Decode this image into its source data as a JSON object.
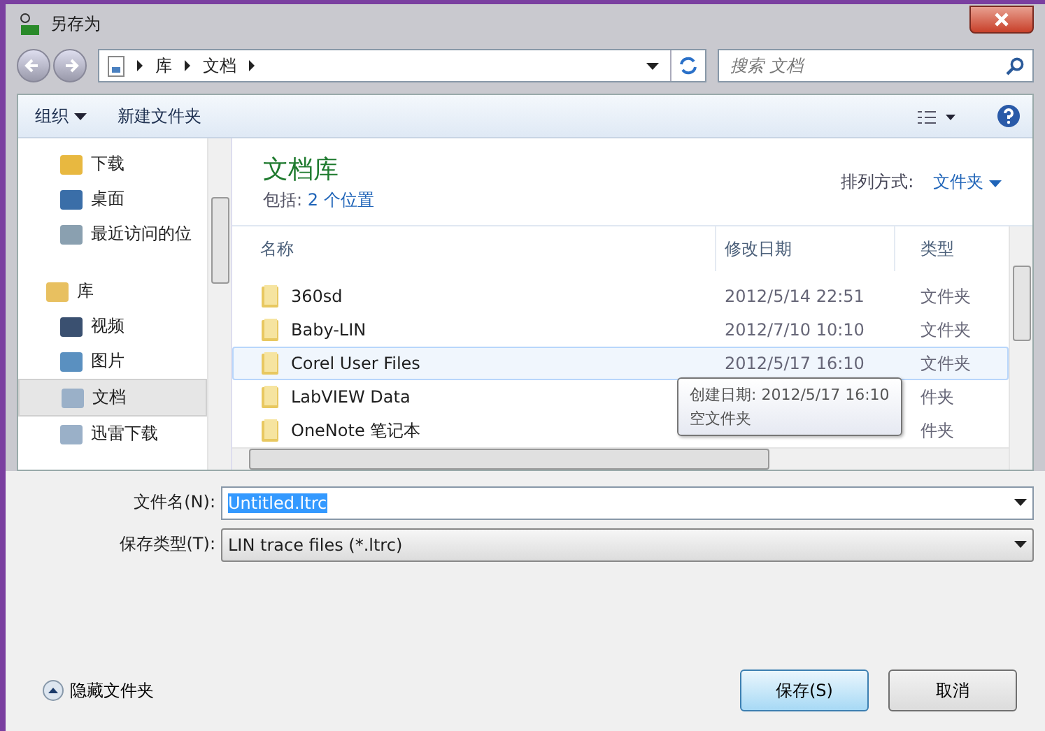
{
  "window": {
    "title": "另存为"
  },
  "address": {
    "crumbs": [
      "库",
      "文档"
    ]
  },
  "search": {
    "placeholder": "搜索 文档"
  },
  "toolbar": {
    "organize": "组织",
    "new_folder": "新建文件夹"
  },
  "nav": {
    "favorites": [
      {
        "label": "下载",
        "kind": "download",
        "selected": false
      },
      {
        "label": "桌面",
        "kind": "desktop",
        "selected": false
      },
      {
        "label": "最近访问的位",
        "kind": "recent",
        "selected": false
      }
    ],
    "library": {
      "label": "库",
      "children": [
        {
          "label": "视频",
          "kind": "video",
          "selected": false
        },
        {
          "label": "图片",
          "kind": "picture",
          "selected": false
        },
        {
          "label": "文档",
          "kind": "document",
          "selected": true
        },
        {
          "label": "迅雷下载",
          "kind": "document",
          "selected": false
        }
      ]
    }
  },
  "library": {
    "title": "文档库",
    "includes_label": "包括:",
    "includes_link": "2 个位置",
    "arrange_label": "排列方式:",
    "arrange_value": "文件夹"
  },
  "columns": [
    "名称",
    "修改日期",
    "类型"
  ],
  "rows": [
    {
      "name": "360sd",
      "date": "2012/5/14 22:51",
      "type": "文件夹",
      "selected": false
    },
    {
      "name": "Baby-LIN",
      "date": "2012/7/10 10:10",
      "type": "文件夹",
      "selected": false
    },
    {
      "name": "Corel User Files",
      "date": "2012/5/17 16:10",
      "type": "文件夹",
      "selected": true
    },
    {
      "name": "LabVIEW Data",
      "type": "件夹",
      "selected": false
    },
    {
      "name": "OneNote 笔记本",
      "type": "件夹",
      "selected": false
    }
  ],
  "tooltip": {
    "lines": [
      "创建日期: 2012/5/17 16:10",
      "空文件夹"
    ]
  },
  "filename": {
    "label": "文件名(N):",
    "value": "Untitled.ltrc"
  },
  "filetype": {
    "label": "保存类型(T):",
    "value": "LIN trace files (*.ltrc)"
  },
  "hide_folders": "隐藏文件夹",
  "buttons": [
    {
      "label": "保存(S)",
      "kind": "primary"
    },
    {
      "label": "取消",
      "kind": "normal"
    }
  ]
}
